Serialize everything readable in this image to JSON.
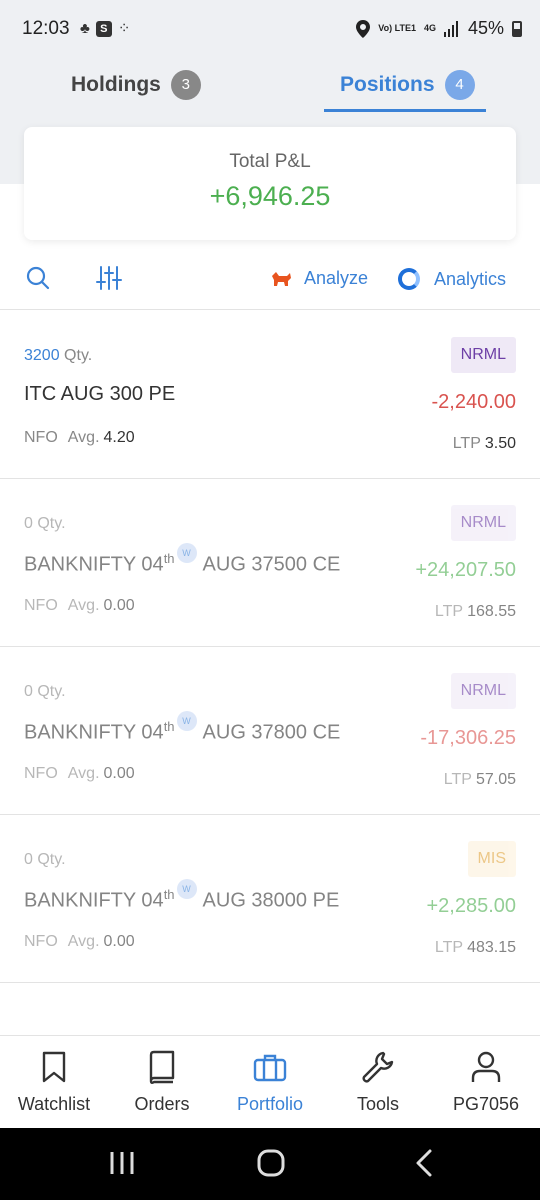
{
  "status_bar": {
    "time": "12:03",
    "network_label": "Vo) LTE1",
    "network_type": "4G",
    "battery": "45%"
  },
  "tabs": [
    {
      "label": "Holdings",
      "count": "3",
      "active": false
    },
    {
      "label": "Positions",
      "count": "4",
      "active": true
    }
  ],
  "pnl": {
    "label": "Total P&L",
    "value": "+6,946.25",
    "color": "#4caf50"
  },
  "toolbar": {
    "search_icon": "search-icon",
    "filter_icon": "filter-icon",
    "analyze_label": "Analyze",
    "analytics_label": "Analytics"
  },
  "positions": [
    {
      "qty": "3200",
      "qty_suffix": "Qty.",
      "symbol_prefix": "ITC AUG 300 PE",
      "symbol_suffix": "",
      "exchange": "NFO",
      "avg_label": "Avg.",
      "avg": "4.20",
      "product": "NRML",
      "pnl": "-2,240.00",
      "ltp_label": "LTP",
      "ltp": "3.50"
    },
    {
      "qty": "0",
      "qty_suffix": "Qty.",
      "symbol_prefix": "BANKNIFTY 04",
      "symbol_sup": "th",
      "weekly": "W",
      "symbol_suffix": "AUG 37500 CE",
      "exchange": "NFO",
      "avg_label": "Avg.",
      "avg": "0.00",
      "product": "NRML",
      "pnl": "+24,207.50",
      "ltp_label": "LTP",
      "ltp": "168.55"
    },
    {
      "qty": "0",
      "qty_suffix": "Qty.",
      "symbol_prefix": "BANKNIFTY 04",
      "symbol_sup": "th",
      "weekly": "W",
      "symbol_suffix": "AUG 37800 CE",
      "exchange": "NFO",
      "avg_label": "Avg.",
      "avg": "0.00",
      "product": "NRML",
      "pnl": "-17,306.25",
      "ltp_label": "LTP",
      "ltp": "57.05"
    },
    {
      "qty": "0",
      "qty_suffix": "Qty.",
      "symbol_prefix": "BANKNIFTY 04",
      "symbol_sup": "th",
      "weekly": "W",
      "symbol_suffix": "AUG 38000 PE",
      "exchange": "NFO",
      "avg_label": "Avg.",
      "avg": "0.00",
      "product": "MIS",
      "pnl": "+2,285.00",
      "ltp_label": "LTP",
      "ltp": "483.15"
    }
  ],
  "bottom_nav": [
    {
      "label": "Watchlist",
      "icon": "bookmark-icon"
    },
    {
      "label": "Orders",
      "icon": "book-icon"
    },
    {
      "label": "Portfolio",
      "icon": "briefcase-icon",
      "active": true
    },
    {
      "label": "Tools",
      "icon": "wrench-icon"
    },
    {
      "label": "PG7056",
      "icon": "user-icon"
    }
  ],
  "colors": {
    "accent": "#3b82d6",
    "profit": "#4caf50",
    "loss": "#d9534f"
  }
}
